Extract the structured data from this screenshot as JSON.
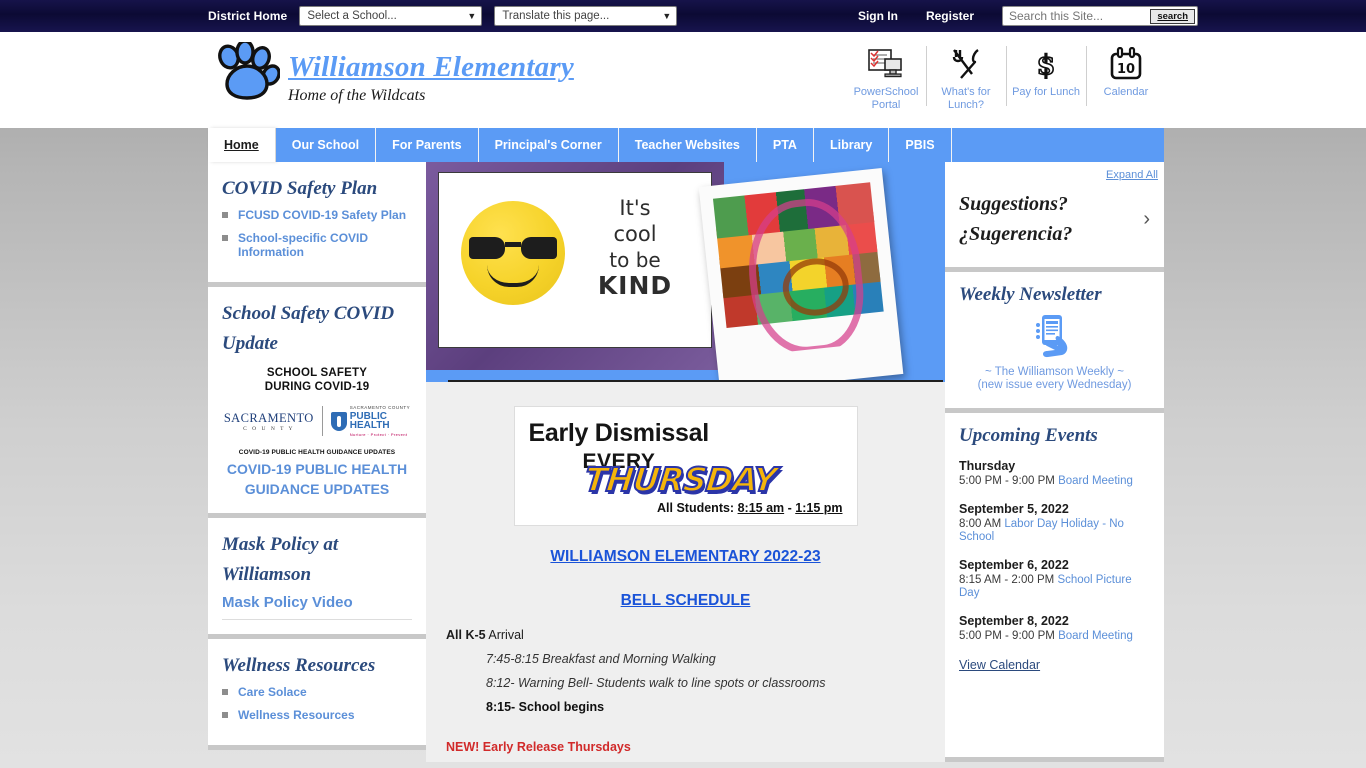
{
  "topbar": {
    "district_home": "District Home",
    "school_select": "Select a School...",
    "translate_select": "Translate this page...",
    "sign_in": "Sign In",
    "register": "Register",
    "search_placeholder": "Search this Site...",
    "search_button": "search"
  },
  "header": {
    "school_name": "Williamson Elementary",
    "tagline": "Home of the Wildcats",
    "icons": [
      {
        "label": "PowerSchool Portal",
        "icon": "powerschool-portal-icon"
      },
      {
        "label": "What's for Lunch?",
        "icon": "utensils-icon"
      },
      {
        "label": "Pay for Lunch",
        "icon": "dollar-sign-icon"
      },
      {
        "label": "Calendar",
        "icon": "calendar-icon"
      }
    ]
  },
  "nav": {
    "items": [
      {
        "label": "Home",
        "active": true
      },
      {
        "label": "Our School",
        "active": false
      },
      {
        "label": "For Parents",
        "active": false
      },
      {
        "label": "Principal's Corner",
        "active": false
      },
      {
        "label": "Teacher Websites",
        "active": false
      },
      {
        "label": "PTA",
        "active": false
      },
      {
        "label": "Library",
        "active": false
      },
      {
        "label": "PBIS",
        "active": false
      }
    ]
  },
  "left_sidebar": {
    "covid_plan": {
      "title": "COVID Safety Plan",
      "links": [
        "FCUSD COVID-19 Safety Plan",
        "School-specific COVID Information"
      ]
    },
    "school_safety": {
      "title": "School Safety COVID Update",
      "image_line1": "SCHOOL SAFETY",
      "image_line2": "DURING COVID-19",
      "logo_sacramento_big": "SACRAMENTO",
      "logo_sacramento_small": "C O U N T Y",
      "logo_ph_l1": "SACRAMENTO COUNTY",
      "logo_ph_l2": "PUBLIC",
      "logo_ph_l3": "HEALTH",
      "logo_ph_l4": "Nurture · Protect · Prevent",
      "caption_small": "COVID-19 PUBLIC HEALTH GUIDANCE UPDATES",
      "link": "COVID-19 PUBLIC HEALTH GUIDANCE UPDATES"
    },
    "mask_policy": {
      "title": "Mask Policy at Williamson",
      "link": "Mask Policy Video"
    },
    "wellness": {
      "title": "Wellness Resources",
      "links": [
        "Care Solace",
        "Wellness Resources"
      ]
    }
  },
  "hero": {
    "poster_text": {
      "l1": "It's",
      "l2": "cool",
      "l3": "to be",
      "l4": "KIND"
    },
    "poster_alt": "cool-to-be-kind-poster",
    "polaroid_alt": "student-artwork-polaroid"
  },
  "main": {
    "dismissal_banner": {
      "line1": "Early Dismissal",
      "line2": "EVERY",
      "line3": "THURSDAY",
      "line4_prefix": "All Students: ",
      "line4_start": "8:15 am",
      "line4_sep": " - ",
      "line4_end": "1:15 pm"
    },
    "bell_heading_1": "WILLIAMSON ELEMENTARY 2022-23",
    "bell_heading_2": "BELL SCHEDULE",
    "arrival_bold": "All K-5",
    "arrival_rest": " Arrival",
    "schedule": [
      {
        "text": "7:45-8:15 Breakfast and Morning Walking",
        "bold": false
      },
      {
        "text": "8:12- Warning Bell- Students walk to line spots or classrooms",
        "bold": false
      },
      {
        "text": "8:15- School begins",
        "bold": true
      }
    ],
    "new_notice": "NEW! Early Release Thursdays"
  },
  "right_sidebar": {
    "expand_all": "Expand All",
    "suggestions": {
      "line1": "Suggestions?",
      "line2": "¿Sugerencia?"
    },
    "newsletter": {
      "title": "Weekly Newsletter",
      "sub1": "~ The Williamson Weekly ~",
      "sub2": "(new issue every Wednesday)"
    },
    "events": {
      "title": "Upcoming Events",
      "items": [
        {
          "date": "Thursday",
          "time": "5:00 PM - 9:00 PM ",
          "name": "Board Meeting"
        },
        {
          "date": "September 5, 2022",
          "time": "8:00 AM ",
          "name": "Labor Day Holiday - No School"
        },
        {
          "date": "September 6, 2022",
          "time": "8:15 AM - 2:00 PM ",
          "name": "School Picture Day"
        },
        {
          "date": "September 8, 2022",
          "time": "5:00 PM - 9:00 PM ",
          "name": "Board Meeting"
        }
      ],
      "view_calendar": "View Calendar"
    }
  },
  "colors": {
    "brand_blue": "#5b9bf5",
    "link_blue": "#5b8fd8",
    "navy": "#0c0a34",
    "heading_navy": "#2b4a7d"
  }
}
